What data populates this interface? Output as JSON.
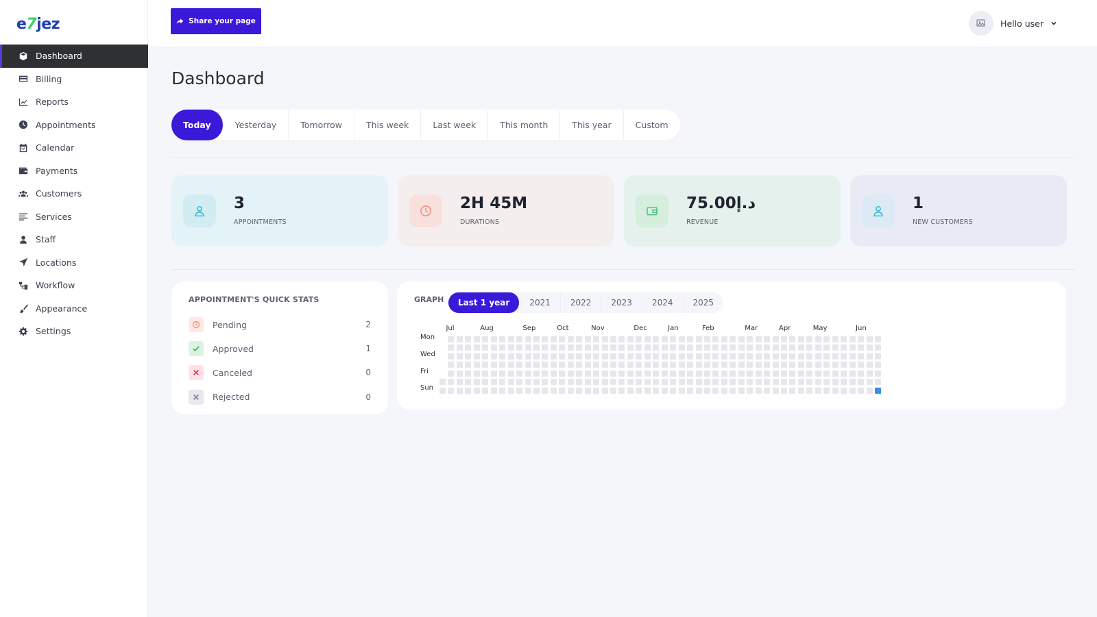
{
  "brand": {
    "logo_part1": "e",
    "logo_part2": "7",
    "logo_part3": "jez"
  },
  "sidebar": {
    "items": [
      {
        "label": "Dashboard",
        "icon": "cube-icon",
        "active": true
      },
      {
        "label": "Billing",
        "icon": "card-icon",
        "active": false
      },
      {
        "label": "Reports",
        "icon": "chart-line-icon",
        "active": false
      },
      {
        "label": "Appointments",
        "icon": "clock-icon",
        "active": false
      },
      {
        "label": "Calendar",
        "icon": "calendar-icon",
        "active": false
      },
      {
        "label": "Payments",
        "icon": "wallet-icon",
        "active": false
      },
      {
        "label": "Customers",
        "icon": "users-icon",
        "active": false
      },
      {
        "label": "Services",
        "icon": "list-icon",
        "active": false
      },
      {
        "label": "Staff",
        "icon": "user-icon",
        "active": false
      },
      {
        "label": "Locations",
        "icon": "location-arrow-icon",
        "active": false
      },
      {
        "label": "Workflow",
        "icon": "sitemap-icon",
        "active": false
      },
      {
        "label": "Appearance",
        "icon": "brush-icon",
        "active": false
      },
      {
        "label": "Settings",
        "icon": "gear-icon",
        "active": false
      }
    ]
  },
  "topbar": {
    "share_label": "Share your page",
    "user_greeting": "Hello user"
  },
  "page": {
    "title": "Dashboard"
  },
  "date_tabs": {
    "items": [
      "Today",
      "Yesterday",
      "Tomorrow",
      "This week",
      "Last week",
      "This month",
      "This year",
      "Custom"
    ],
    "active": 0
  },
  "kpis": [
    {
      "value": "3",
      "label": "APPOINTMENTS",
      "icon": "user-icon",
      "bg": "#e3f3f8",
      "icon_bg": "#d2ecf4",
      "icon_color": "#2fb6d4"
    },
    {
      "value": "2H 45M",
      "label": "DURATIONS",
      "icon": "clock-icon",
      "bg": "#f5eeee",
      "icon_bg": "#f8e0dc",
      "icon_color": "#ee8a74"
    },
    {
      "value": "75.00د.إ",
      "label": "REVENUE",
      "icon": "wallet-icon",
      "bg": "#e4f1ec",
      "icon_bg": "#d5eede",
      "icon_color": "#48c27a"
    },
    {
      "value": "1",
      "label": "NEW CUSTOMERS",
      "icon": "user-icon",
      "bg": "#e8eaf6",
      "icon_bg": "#dceaf6",
      "icon_color": "#2fb6d4"
    }
  ],
  "quick_stats": {
    "title": "APPOINTMENT'S QUICK STATS",
    "rows": [
      {
        "label": "Pending",
        "value": "2",
        "icon": "clock-icon",
        "icon_bg": "#fde9e4",
        "icon_color": "#ee8a74"
      },
      {
        "label": "Approved",
        "value": "1",
        "icon": "check-icon",
        "icon_bg": "#dcf3e2",
        "icon_color": "#35b657"
      },
      {
        "label": "Canceled",
        "value": "0",
        "icon": "close-icon",
        "icon_bg": "#fde2e6",
        "icon_color": "#e8385a"
      },
      {
        "label": "Rejected",
        "value": "0",
        "icon": "close-icon",
        "icon_bg": "#e8e9ee",
        "icon_color": "#7d8494"
      }
    ]
  },
  "graph": {
    "title": "GRAPH",
    "tabs": [
      "Last 1 year",
      "2021",
      "2022",
      "2023",
      "2024",
      "2025"
    ],
    "active_tab": 0,
    "months": [
      "Jul",
      "Aug",
      "Sep",
      "Oct",
      "Nov",
      "Dec",
      "Jan",
      "Feb",
      "Mar",
      "Apr",
      "May",
      "Jun"
    ],
    "days": [
      "Mon",
      "Wed",
      "Fri",
      "Sun"
    ],
    "weeks": 52,
    "highlight_week": 51,
    "highlight_day": 6,
    "empty_color": "#e6e7eb",
    "active_color": "#3a8de6"
  }
}
